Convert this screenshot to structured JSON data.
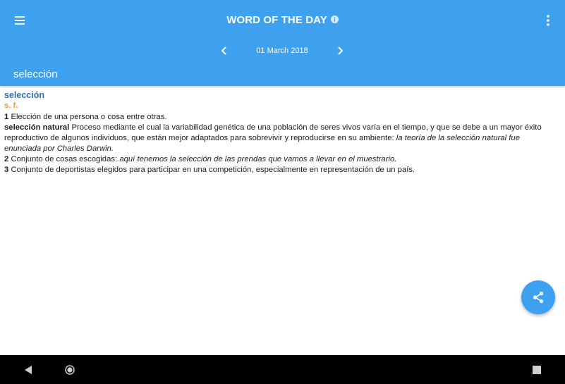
{
  "appbar": {
    "title": "WORD OF THE DAY",
    "date": "01 March 2018",
    "word": "selección",
    "color": "#3da1f0"
  },
  "icons": {
    "menu": "hamburger-menu-icon",
    "info": "info-icon",
    "more": "more-vert-icon",
    "prev": "chevron-left-icon",
    "next": "chevron-right-icon",
    "share": "share-icon",
    "nav_back": "back-triangle-icon",
    "nav_home": "home-circle-icon",
    "nav_recent": "recent-square-icon"
  },
  "entry": {
    "word": "selección",
    "pos": "s. f.",
    "def1": {
      "num": "1",
      "text": "Elección de una persona o cosa entre otras."
    },
    "compound": {
      "term": "selección natural",
      "text": "Proceso mediante el cual la variabilidad genética de una población de seres vivos varía en el tiempo, y que se debe a un mayor éxito reproductivo de algunos individuos, que están mejor adaptados para sobrevivir y reproducirse en su ambiente:",
      "example": "la teoría de la selección natural fue enunciada por Charles Darwin."
    },
    "def2": {
      "num": "2",
      "text": "Conjunto de cosas escogidas:",
      "example": "aquí tenemos la selección de las prendas que vamos a llevar en el muestrario."
    },
    "def3": {
      "num": "3",
      "text": "Conjunto de deportistas elegidos para participar en una competición, especialmente en representación de un país."
    }
  }
}
